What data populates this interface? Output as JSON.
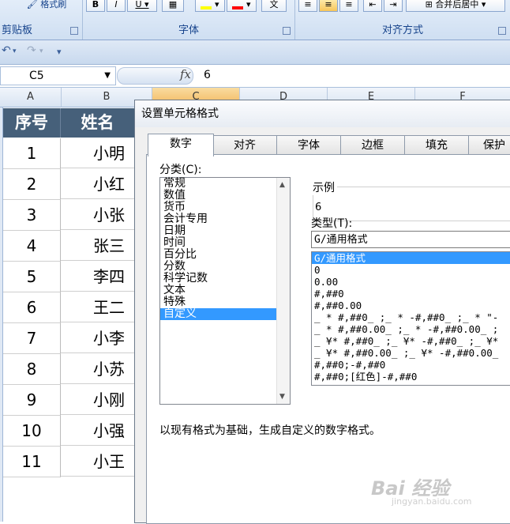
{
  "ribbon": {
    "format_painter": "格式刷",
    "groups": {
      "clipboard": "剪贴板",
      "font": "字体",
      "alignment": "对齐方式"
    },
    "merge_center": "合并后居中"
  },
  "formula_bar": {
    "name_box": "C5",
    "fx": "fx",
    "value": "6"
  },
  "columns": [
    "A",
    "B",
    "C",
    "D",
    "E",
    "F"
  ],
  "table": {
    "headers": {
      "index": "序号",
      "name": "姓名"
    },
    "rows": [
      {
        "index": "1",
        "name": "小明"
      },
      {
        "index": "2",
        "name": "小红"
      },
      {
        "index": "3",
        "name": "小张"
      },
      {
        "index": "4",
        "name": "张三"
      },
      {
        "index": "5",
        "name": "李四"
      },
      {
        "index": "6",
        "name": "王二"
      },
      {
        "index": "7",
        "name": "小李"
      },
      {
        "index": "8",
        "name": "小苏"
      },
      {
        "index": "9",
        "name": "小刚"
      },
      {
        "index": "10",
        "name": "小强"
      },
      {
        "index": "11",
        "name": "小王"
      }
    ]
  },
  "dialog": {
    "title": "设置单元格格式",
    "tabs": [
      "数字",
      "对齐",
      "字体",
      "边框",
      "填充",
      "保护"
    ],
    "category_label": "分类(C):",
    "categories": [
      "常规",
      "数值",
      "货币",
      "会计专用",
      "日期",
      "时间",
      "百分比",
      "分数",
      "科学记数",
      "文本",
      "特殊",
      "自定义"
    ],
    "selected_category": "自定义",
    "sample_label": "示例",
    "sample_value": "6",
    "type_label": "类型(T):",
    "type_value": "G/通用格式",
    "formats": [
      "G/通用格式",
      "0",
      "0.00",
      "#,##0",
      "#,##0.00",
      "_ * #,##0_ ;_ * -#,##0_ ;_ * \"-",
      "_ * #,##0.00_ ;_ * -#,##0.00_ ;",
      "_ ¥* #,##0_ ;_ ¥* -#,##0_ ;_ ¥*",
      "_ ¥* #,##0.00_ ;_ ¥* -#,##0.00_",
      "#,##0;-#,##0",
      "#,##0;[红色]-#,##0"
    ],
    "description": "以现有格式为基础，生成自定义的数字格式。"
  },
  "watermark": {
    "text": "Bai 经验",
    "url": "jingyan.baidu.com"
  }
}
